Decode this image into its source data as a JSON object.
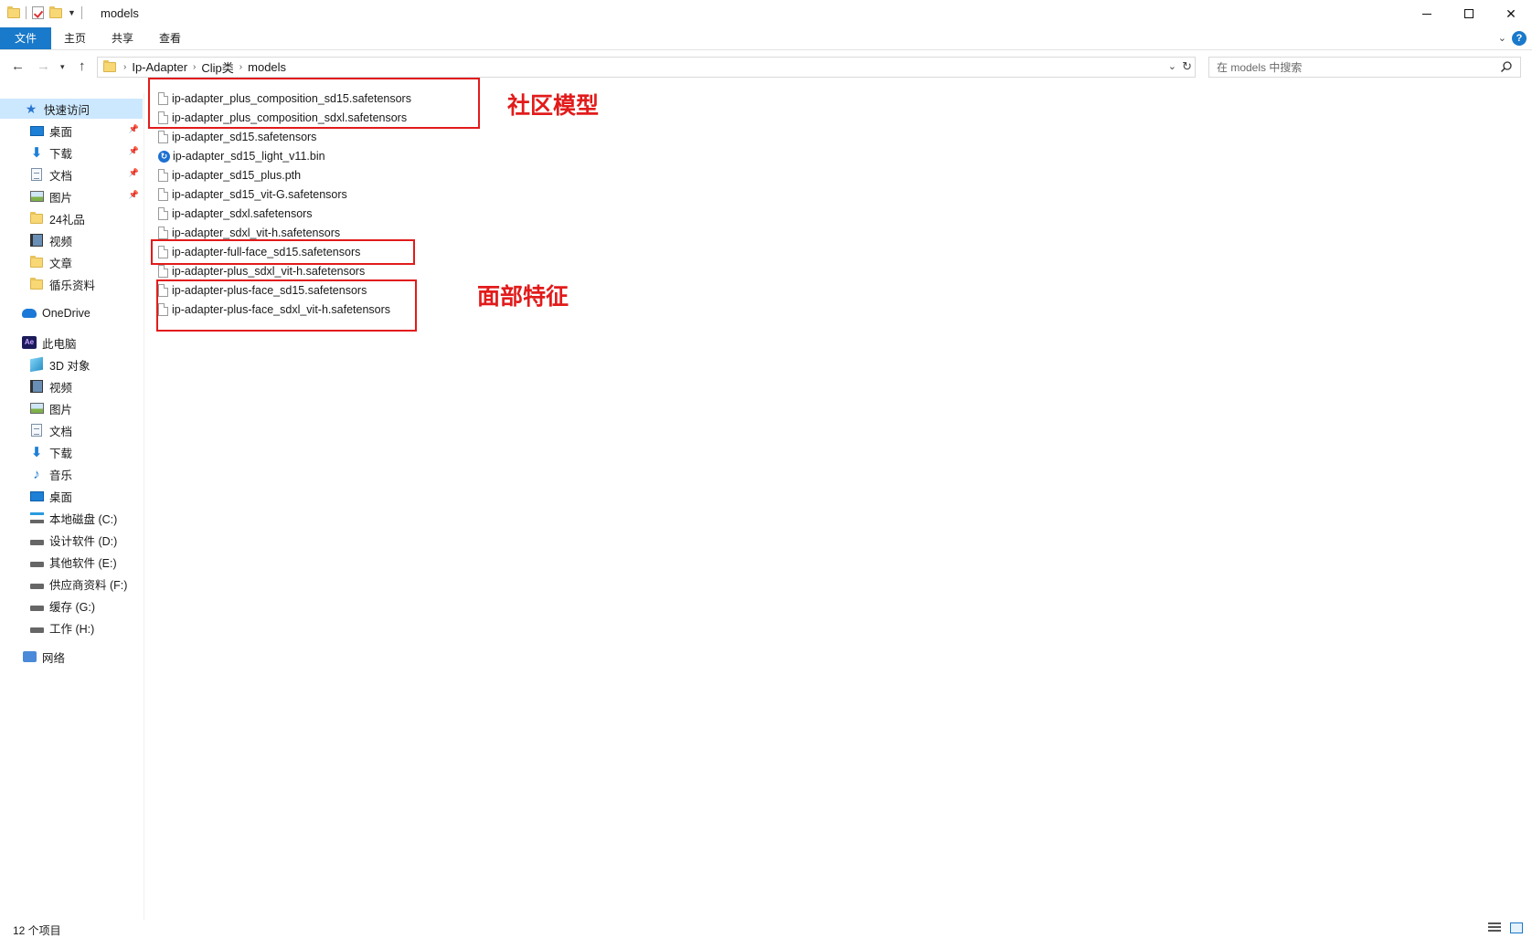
{
  "window": {
    "title": "models"
  },
  "ribbon": {
    "tabs": [
      "文件",
      "主页",
      "共享",
      "查看"
    ]
  },
  "address": {
    "breadcrumbs": [
      "Ip-Adapter",
      "Clip类",
      "models"
    ],
    "search_placeholder": "在 models 中搜索"
  },
  "sidebar": {
    "items": [
      {
        "label": "快速访问",
        "icon": "quick-access-star-icon"
      },
      {
        "label": "桌面",
        "icon": "desktop-icon",
        "pinned": true
      },
      {
        "label": "下载",
        "icon": "download-arrow-icon",
        "pinned": true
      },
      {
        "label": "文档",
        "icon": "document-icon",
        "pinned": true
      },
      {
        "label": "图片",
        "icon": "picture-icon",
        "pinned": true
      },
      {
        "label": "24礼品",
        "icon": "folder-icon"
      },
      {
        "label": "视频",
        "icon": "video-icon"
      },
      {
        "label": "文章",
        "icon": "folder-icon"
      },
      {
        "label": "循乐资料",
        "icon": "folder-icon"
      },
      {
        "label": "OneDrive",
        "icon": "onedrive-cloud-icon"
      },
      {
        "label": "此电脑",
        "icon": "this-pc-icon"
      },
      {
        "label": "3D 对象",
        "icon": "3d-objects-icon"
      },
      {
        "label": "视频",
        "icon": "video-icon"
      },
      {
        "label": "图片",
        "icon": "picture-icon"
      },
      {
        "label": "文档",
        "icon": "document-icon"
      },
      {
        "label": "下载",
        "icon": "download-arrow-icon"
      },
      {
        "label": "音乐",
        "icon": "music-note-icon"
      },
      {
        "label": "桌面",
        "icon": "desktop-icon"
      },
      {
        "label": "本地磁盘 (C:)",
        "icon": "system-drive-icon"
      },
      {
        "label": "设计软件 (D:)",
        "icon": "drive-icon"
      },
      {
        "label": "其他软件 (E:)",
        "icon": "drive-icon"
      },
      {
        "label": "供应商资料 (F:)",
        "icon": "drive-icon"
      },
      {
        "label": "缓存 (G:)",
        "icon": "drive-icon"
      },
      {
        "label": "工作 (H:)",
        "icon": "drive-icon"
      },
      {
        "label": "网络",
        "icon": "network-icon"
      }
    ]
  },
  "files": [
    {
      "name": "ip-adapter_plus_composition_sd15.safetensors",
      "icon": "file-icon"
    },
    {
      "name": "ip-adapter_plus_composition_sdxl.safetensors",
      "icon": "file-icon"
    },
    {
      "name": "ip-adapter_sd15.safetensors",
      "icon": "file-icon"
    },
    {
      "name": "ip-adapter_sd15_light_v11.bin",
      "icon": "bin-file-icon"
    },
    {
      "name": "ip-adapter_sd15_plus.pth",
      "icon": "file-icon"
    },
    {
      "name": "ip-adapter_sd15_vit-G.safetensors",
      "icon": "file-icon"
    },
    {
      "name": "ip-adapter_sdxl.safetensors",
      "icon": "file-icon"
    },
    {
      "name": "ip-adapter_sdxl_vit-h.safetensors",
      "icon": "file-icon"
    },
    {
      "name": "ip-adapter-full-face_sd15.safetensors",
      "icon": "file-icon"
    },
    {
      "name": "ip-adapter-plus_sdxl_vit-h.safetensors",
      "icon": "file-icon"
    },
    {
      "name": "ip-adapter-plus-face_sd15.safetensors",
      "icon": "file-icon"
    },
    {
      "name": "ip-adapter-plus-face_sdxl_vit-h.safetensors",
      "icon": "file-icon"
    }
  ],
  "annotations": {
    "community_label": "社区模型",
    "face_label": "面部特征",
    "color": "#e21b1b"
  },
  "status": {
    "item_count": "12 个项目"
  },
  "colors": {
    "accent": "#1979ca",
    "selection": "#cce8ff"
  }
}
